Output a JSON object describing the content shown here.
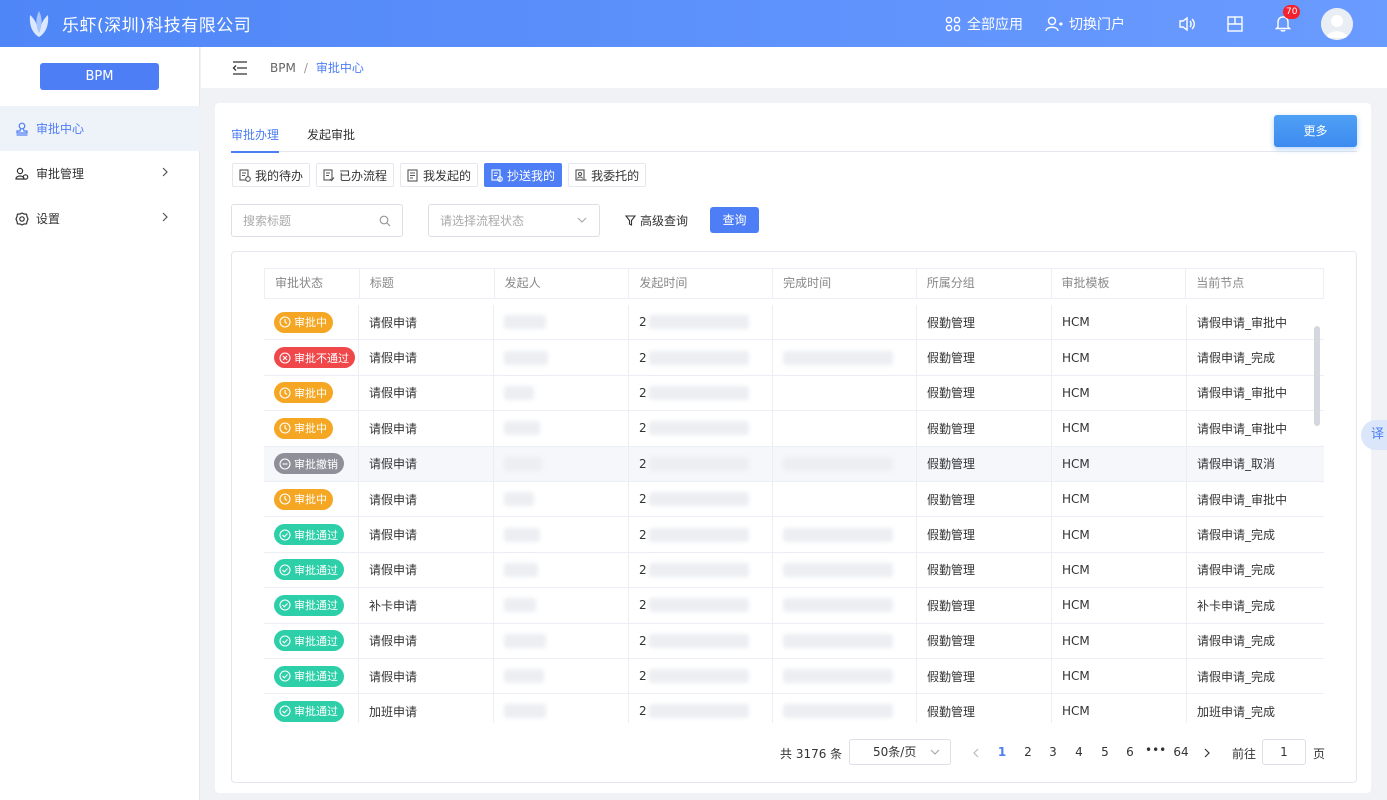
{
  "header": {
    "company": "乐虾(深圳)科技有限公司",
    "all_apps": "全部应用",
    "switch_portal": "切换门户",
    "notification_count": "70"
  },
  "sidebar": {
    "app_button": "BPM",
    "items": [
      {
        "label": "审批中心",
        "icon": "stamp-icon",
        "active": true
      },
      {
        "label": "审批管理",
        "icon": "manage-icon",
        "active": false
      },
      {
        "label": "设置",
        "icon": "gear-icon",
        "active": false
      }
    ]
  },
  "breadcrumb": {
    "root": "BPM",
    "separator": "/",
    "current": "审批中心"
  },
  "tabs": [
    {
      "label": "审批办理",
      "active": true
    },
    {
      "label": "发起审批",
      "active": false
    }
  ],
  "more_button": "更多",
  "subtabs": [
    {
      "label": "我的待办",
      "active": false
    },
    {
      "label": "已办流程",
      "active": false
    },
    {
      "label": "我发起的",
      "active": false
    },
    {
      "label": "抄送我的",
      "active": true
    },
    {
      "label": "我委托的",
      "active": false
    }
  ],
  "filters": {
    "search_placeholder": "搜索标题",
    "status_placeholder": "请选择流程状态",
    "advanced": "高级查询",
    "query_button": "查询"
  },
  "table": {
    "columns": [
      "审批状态",
      "标题",
      "发起人",
      "发起时间",
      "完成时间",
      "所属分组",
      "审批模板",
      "当前节点"
    ],
    "rows": [
      {
        "status": "审批中",
        "status_kind": "pending",
        "title": "请假申请",
        "start_prefix": "2",
        "has_finish": false,
        "group": "假勤管理",
        "template": "HCM",
        "node": "请假申请_审批中"
      },
      {
        "status": "审批不通过",
        "status_kind": "rejected",
        "title": "请假申请",
        "start_prefix": "2",
        "has_finish": true,
        "group": "假勤管理",
        "template": "HCM",
        "node": "请假申请_完成"
      },
      {
        "status": "审批中",
        "status_kind": "pending",
        "title": "请假申请",
        "start_prefix": "2",
        "has_finish": false,
        "group": "假勤管理",
        "template": "HCM",
        "node": "请假申请_审批中"
      },
      {
        "status": "审批中",
        "status_kind": "pending",
        "title": "请假申请",
        "start_prefix": "2",
        "has_finish": false,
        "group": "假勤管理",
        "template": "HCM",
        "node": "请假申请_审批中"
      },
      {
        "status": "审批撤销",
        "status_kind": "revoked",
        "title": "请假申请",
        "start_prefix": "2",
        "has_finish": true,
        "group": "假勤管理",
        "template": "HCM",
        "node": "请假申请_取消"
      },
      {
        "status": "审批中",
        "status_kind": "pending",
        "title": "请假申请",
        "start_prefix": "2",
        "has_finish": false,
        "group": "假勤管理",
        "template": "HCM",
        "node": "请假申请_审批中"
      },
      {
        "status": "审批通过",
        "status_kind": "approved",
        "title": "请假申请",
        "start_prefix": "2",
        "has_finish": true,
        "group": "假勤管理",
        "template": "HCM",
        "node": "请假申请_完成"
      },
      {
        "status": "审批通过",
        "status_kind": "approved",
        "title": "请假申请",
        "start_prefix": "2",
        "has_finish": true,
        "group": "假勤管理",
        "template": "HCM",
        "node": "请假申请_完成"
      },
      {
        "status": "审批通过",
        "status_kind": "approved",
        "title": "补卡申请",
        "start_prefix": "2",
        "has_finish": true,
        "group": "假勤管理",
        "template": "HCM",
        "node": "补卡申请_完成"
      },
      {
        "status": "审批通过",
        "status_kind": "approved",
        "title": "请假申请",
        "start_prefix": "2",
        "has_finish": true,
        "group": "假勤管理",
        "template": "HCM",
        "node": "请假申请_完成"
      },
      {
        "status": "审批通过",
        "status_kind": "approved",
        "title": "请假申请",
        "start_prefix": "2",
        "has_finish": true,
        "group": "假勤管理",
        "template": "HCM",
        "node": "请假申请_完成"
      },
      {
        "status": "审批通过",
        "status_kind": "approved",
        "title": "加班申请",
        "start_prefix": "2",
        "has_finish": true,
        "group": "假勤管理",
        "template": "HCM",
        "node": "加班申请_完成"
      }
    ]
  },
  "status_colors": {
    "pending": "#f5a623",
    "rejected": "#f0474b",
    "revoked": "#8e9099",
    "approved": "#2ccfa7"
  },
  "pagination": {
    "total": "共 3176 条",
    "page_size": "50条/页",
    "pages": [
      "1",
      "2",
      "3",
      "4",
      "5",
      "6",
      "•••",
      "64"
    ],
    "current_page": "1",
    "goto_label": "前往",
    "goto_value": "1",
    "page_unit": "页"
  },
  "floating_tab": "译",
  "colors": {
    "primary": "#4e7ef5",
    "header": "#5b8ff9"
  }
}
